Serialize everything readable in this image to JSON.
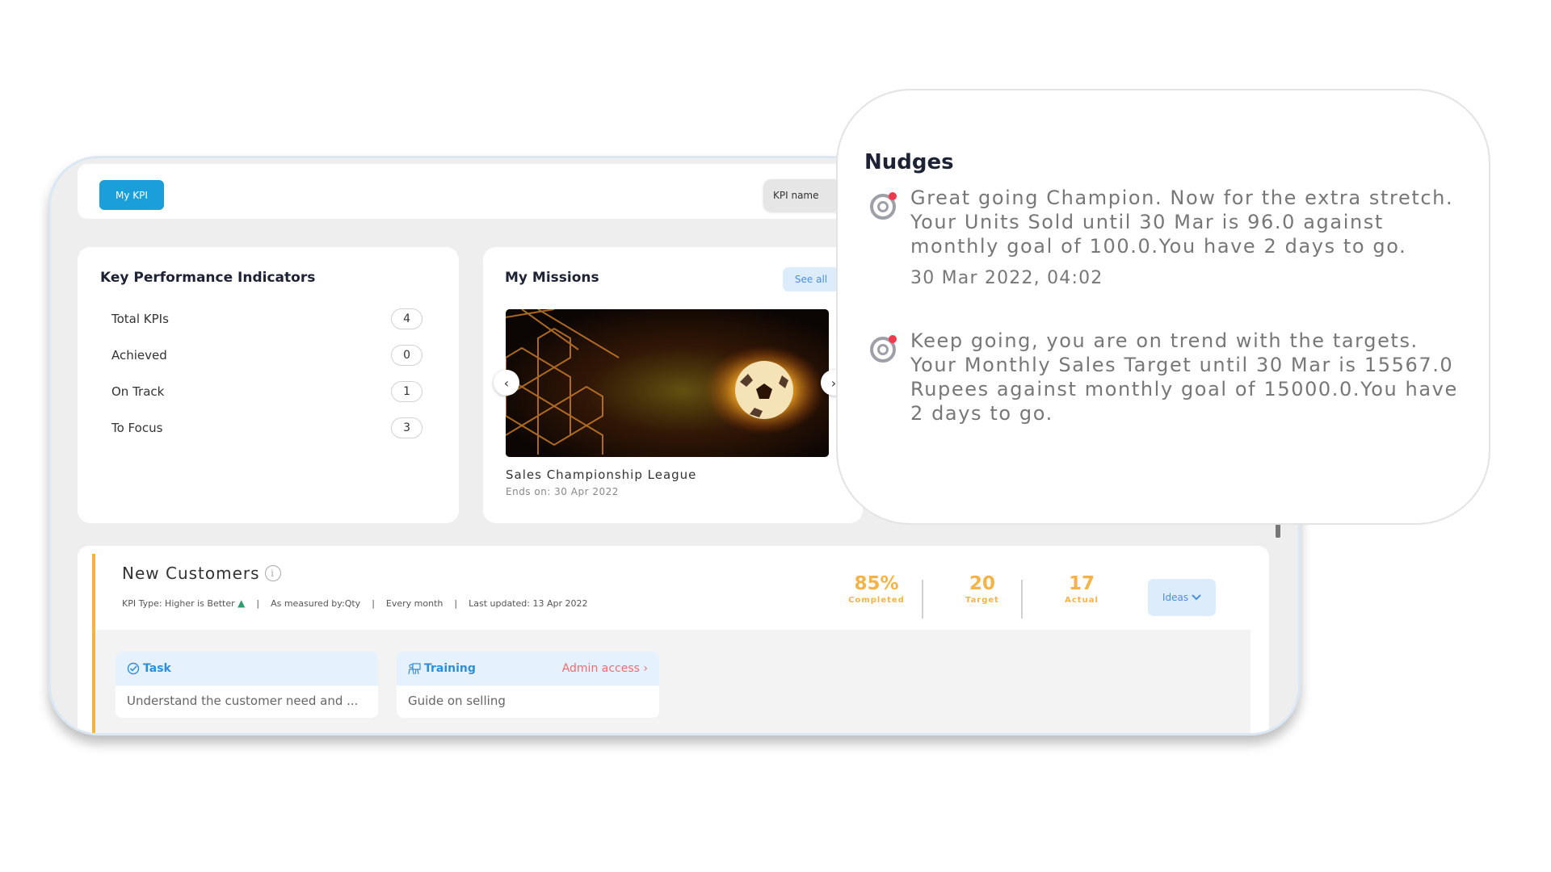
{
  "header": {
    "my_kpi_label": "My KPI",
    "kpi_name_label": "KPI name"
  },
  "kpi_summary": {
    "title": "Key Performance Indicators",
    "rows": [
      {
        "label": "Total KPIs",
        "value": "4"
      },
      {
        "label": "Achieved",
        "value": "0"
      },
      {
        "label": "On Track",
        "value": "1"
      },
      {
        "label": "To Focus",
        "value": "3"
      }
    ]
  },
  "missions": {
    "title": "My Missions",
    "see_all_label": "See all",
    "current": {
      "name": "Sales Championship League",
      "ends": "Ends on: 30 Apr 2022",
      "image": "flaming-soccer-ball-net"
    }
  },
  "kpi_detail": {
    "title": "New Customers",
    "meta": {
      "type": "KPI Type: Higher is Better",
      "measured_by": "As measured by:Qty",
      "frequency": "Every month",
      "last_updated": "Last updated: 13 Apr 2022",
      "separator": "|"
    },
    "stats": [
      {
        "value": "85%",
        "label": "Completed"
      },
      {
        "value": "20",
        "label": "Target"
      },
      {
        "value": "17",
        "label": "Actual"
      }
    ],
    "ideas_label": "Ideas",
    "accent_color": "#f4b33f",
    "items": [
      {
        "type": "Task",
        "icon": "check-circle-icon",
        "text": "Understand the customer need and ...",
        "admin_label": ""
      },
      {
        "type": "Training",
        "icon": "training-icon",
        "text": "Guide on selling",
        "admin_label": "Admin access ›"
      }
    ]
  },
  "nudges": {
    "title": "Nudges",
    "items": [
      {
        "text": "Great going Champion. Now for the extra stretch. Your Units Sold until 30 Mar is 96.0 against monthly goal of 100.0.You have 2 days to go.",
        "time": "30 Mar 2022, 04:02"
      },
      {
        "text": "Keep going, you are on trend with the targets. Your Monthly Sales Target until 30 Mar is 15567.0 Rupees against monthly goal of 15000.0.You have 2 days to go.",
        "time": ""
      }
    ]
  }
}
